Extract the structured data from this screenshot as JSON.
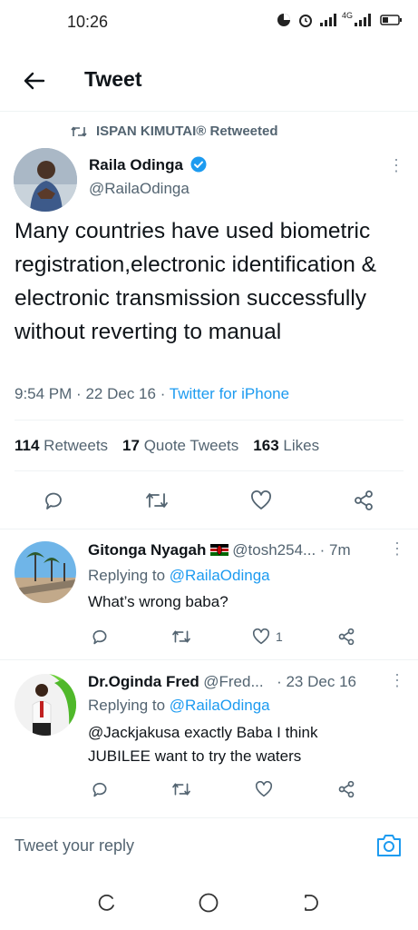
{
  "status_bar": {
    "time": "10:26",
    "network": "4G"
  },
  "header": {
    "title": "Tweet"
  },
  "retweet_line": {
    "text": "ISPAN KIMUTAI® Retweeted"
  },
  "tweet": {
    "name": "Raila Odinga",
    "handle": "@RailaOdinga",
    "text": "Many countries have used biometric registration,electronic identification & electronic transmission successfully without reverting to manual",
    "time": "9:54 PM",
    "date": "22 Dec 16",
    "source": "Twitter for iPhone",
    "sep": "·",
    "stats": {
      "retweets_count": "114",
      "retweets_label": "Retweets",
      "quotes_count": "17",
      "quotes_label": "Quote Tweets",
      "likes_count": "163",
      "likes_label": "Likes"
    }
  },
  "replies": [
    {
      "name": "Gitonga Nyagah",
      "handle": "@tosh254...",
      "time": "· 7m",
      "replying_prefix": "Replying to",
      "replying_to": "@RailaOdinga",
      "text": "What’s wrong baba?",
      "like_count": "1"
    },
    {
      "name": "Dr.Oginda Fred",
      "handle": "@Fred...",
      "time": "· 23 Dec 16",
      "replying_prefix": "Replying to",
      "replying_to": "@RailaOdinga",
      "text_line1": "@Jackjakusa exactly Baba I think",
      "text_line2": "JUBILEE want to try the waters"
    }
  ],
  "compose": {
    "placeholder": "Tweet your reply"
  },
  "colors": {
    "accent": "#1d9bf0",
    "secondary_text": "#536471",
    "primary_text": "#0f1419",
    "divider": "#eff3f4"
  }
}
